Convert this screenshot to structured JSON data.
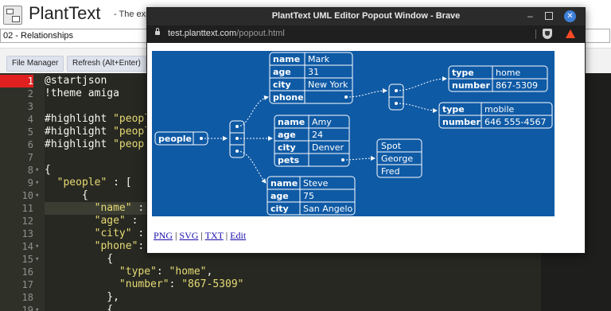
{
  "app": {
    "title": "PlantText",
    "tagline": "- The exp",
    "diagram_select": "02 - Relationships",
    "toolbar": {
      "file_manager": "File Manager",
      "refresh": "Refresh (Alt+Enter)"
    }
  },
  "editor": {
    "lines": [
      {
        "n": "1",
        "fold": "",
        "parts": [
          [
            "n",
            "@startjson"
          ]
        ]
      },
      {
        "n": "2",
        "fold": "",
        "parts": [
          [
            "n",
            "!theme amiga"
          ]
        ]
      },
      {
        "n": "3",
        "fold": "",
        "parts": [
          [
            "n",
            ""
          ]
        ]
      },
      {
        "n": "4",
        "fold": "",
        "parts": [
          [
            "n",
            "#highlight "
          ],
          [
            "s",
            "\"peopl"
          ]
        ]
      },
      {
        "n": "5",
        "fold": "",
        "parts": [
          [
            "n",
            "#highlight "
          ],
          [
            "s",
            "\"peopl"
          ]
        ]
      },
      {
        "n": "6",
        "fold": "",
        "parts": [
          [
            "n",
            "#highlight "
          ],
          [
            "s",
            "\"peop"
          ]
        ]
      },
      {
        "n": "7",
        "fold": "",
        "parts": [
          [
            "n",
            ""
          ]
        ]
      },
      {
        "n": "8",
        "fold": "▾",
        "parts": [
          [
            "n",
            "{"
          ]
        ]
      },
      {
        "n": "9",
        "fold": "▾",
        "parts": [
          [
            "n",
            "  "
          ],
          [
            "s",
            "\"people\""
          ],
          [
            "n",
            " : ["
          ]
        ]
      },
      {
        "n": "10",
        "fold": "▾",
        "parts": [
          [
            "n",
            "      {"
          ]
        ]
      },
      {
        "n": "11",
        "fold": "",
        "parts": [
          [
            "n",
            "        "
          ],
          [
            "s",
            "\"name\""
          ],
          [
            "n",
            " :"
          ]
        ]
      },
      {
        "n": "12",
        "fold": "",
        "parts": [
          [
            "n",
            "        "
          ],
          [
            "s",
            "\"age\""
          ],
          [
            "n",
            " :"
          ]
        ]
      },
      {
        "n": "13",
        "fold": "",
        "parts": [
          [
            "n",
            "        "
          ],
          [
            "s",
            "\"city\""
          ],
          [
            "n",
            " :"
          ]
        ]
      },
      {
        "n": "14",
        "fold": "▾",
        "parts": [
          [
            "n",
            "        "
          ],
          [
            "s",
            "\"phone\""
          ],
          [
            "n",
            ":"
          ]
        ]
      },
      {
        "n": "15",
        "fold": "▾",
        "parts": [
          [
            "n",
            "          {"
          ]
        ]
      },
      {
        "n": "16",
        "fold": "",
        "parts": [
          [
            "n",
            "            "
          ],
          [
            "s",
            "\"type\""
          ],
          [
            "n",
            ": "
          ],
          [
            "s",
            "\"home\""
          ],
          [
            "n",
            ","
          ]
        ]
      },
      {
        "n": "17",
        "fold": "",
        "parts": [
          [
            "n",
            "            "
          ],
          [
            "s",
            "\"number\""
          ],
          [
            "n",
            ": "
          ],
          [
            "s",
            "\"867-5309\""
          ]
        ]
      },
      {
        "n": "18",
        "fold": "",
        "parts": [
          [
            "n",
            "          },"
          ]
        ]
      },
      {
        "n": "19",
        "fold": "▾",
        "parts": [
          [
            "n",
            "          {"
          ]
        ]
      }
    ],
    "error_line": "1",
    "active_line": "11"
  },
  "popout": {
    "title": "PlantText UML Editor Popout Window - Brave",
    "url_host": "test.planttext.com",
    "url_path": "/popout.html",
    "links": [
      "PNG",
      "SVG",
      "TXT",
      "Edit"
    ],
    "link_sep": "|"
  },
  "diagram": {
    "root": "people",
    "labels": {
      "name": "name",
      "age": "age",
      "city": "city",
      "phone": "phone",
      "pets": "pets",
      "type": "type",
      "number": "number"
    },
    "mark": {
      "name": "Mark",
      "age": "31",
      "city": "New York"
    },
    "amy": {
      "name": "Amy",
      "age": "24",
      "city": "Denver"
    },
    "steve": {
      "name": "Steve",
      "age": "75",
      "city": "San Angelo"
    },
    "phone_home": {
      "type": "home",
      "number": "867-5309"
    },
    "phone_mobile": {
      "type": "mobile",
      "number": "646 555-4567"
    },
    "pets": [
      "Spot",
      "George",
      "Fred"
    ]
  }
}
